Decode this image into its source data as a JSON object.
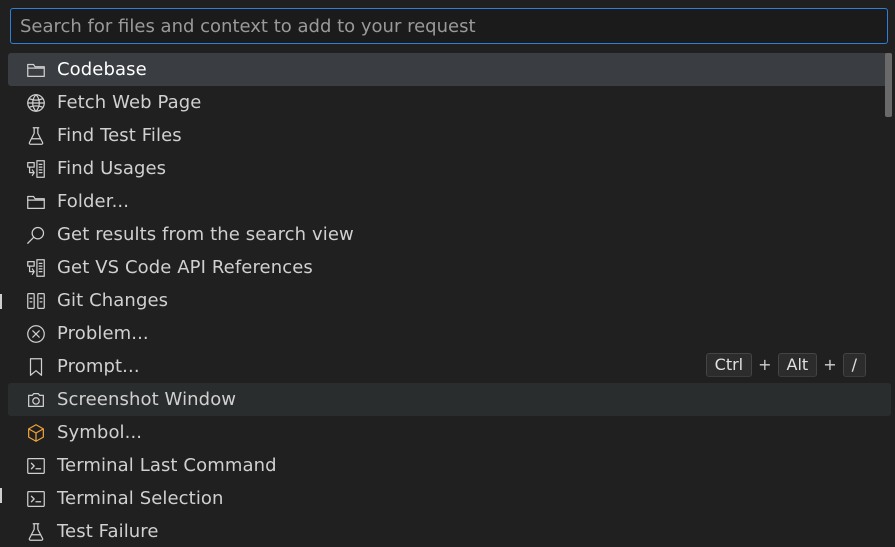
{
  "search": {
    "placeholder": "Search for files and context to add to your request"
  },
  "items": [
    {
      "label": "Codebase",
      "icon": "folder-icon"
    },
    {
      "label": "Fetch Web Page",
      "icon": "globe-icon"
    },
    {
      "label": "Find Test Files",
      "icon": "beaker-icon"
    },
    {
      "label": "Find Usages",
      "icon": "references-icon"
    },
    {
      "label": "Folder...",
      "icon": "folder-icon"
    },
    {
      "label": "Get results from the search view",
      "icon": "search-icon"
    },
    {
      "label": "Get VS Code API References",
      "icon": "references-icon"
    },
    {
      "label": "Git Changes",
      "icon": "diff-icon"
    },
    {
      "label": "Problem...",
      "icon": "error-circle-icon"
    },
    {
      "label": "Prompt...",
      "icon": "bookmark-icon"
    },
    {
      "label": "Screenshot Window",
      "icon": "camera-icon"
    },
    {
      "label": "Symbol...",
      "icon": "symbol-cube-icon"
    },
    {
      "label": "Terminal Last Command",
      "icon": "terminal-icon"
    },
    {
      "label": "Terminal Selection",
      "icon": "terminal-icon"
    },
    {
      "label": "Test Failure",
      "icon": "beaker-icon"
    }
  ],
  "keybinding": {
    "keys": [
      "Ctrl",
      "Alt",
      "/"
    ],
    "separator": "+"
  },
  "colors": {
    "accent_border": "#2f7fd6",
    "selected_background": "#3a3d41",
    "hover_background": "#2a2d2e",
    "symbol_icon": "#f0a23a"
  }
}
